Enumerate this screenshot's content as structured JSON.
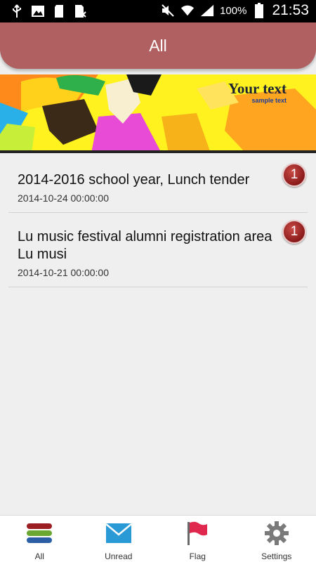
{
  "status_bar": {
    "battery_percent": "100%",
    "time": "21:53",
    "left_icons": [
      "usb-icon",
      "image-icon",
      "sd-card-icon",
      "sim-icon"
    ],
    "right_icons": [
      "mute-icon",
      "wifi-icon",
      "signal-icon",
      "battery-icon"
    ]
  },
  "header": {
    "title": "All"
  },
  "banner": {
    "headline": "Your text",
    "subtext": "sample text"
  },
  "items": [
    {
      "title": "2014-2016 school year, Lunch tender",
      "date": "2014-10-24 00:00:00",
      "badge": "1"
    },
    {
      "title": "Lu music festival alumni registration area Lu musi",
      "date": "2014-10-21 00:00:00",
      "badge": "1"
    }
  ],
  "nav": {
    "all": "All",
    "unread": "Unread",
    "flag": "Flag",
    "settings": "Settings"
  },
  "colors": {
    "header": "#b06060",
    "badge": "#8a1a1a",
    "flag": "#e0284f",
    "envelope": "#2a9ad6"
  }
}
